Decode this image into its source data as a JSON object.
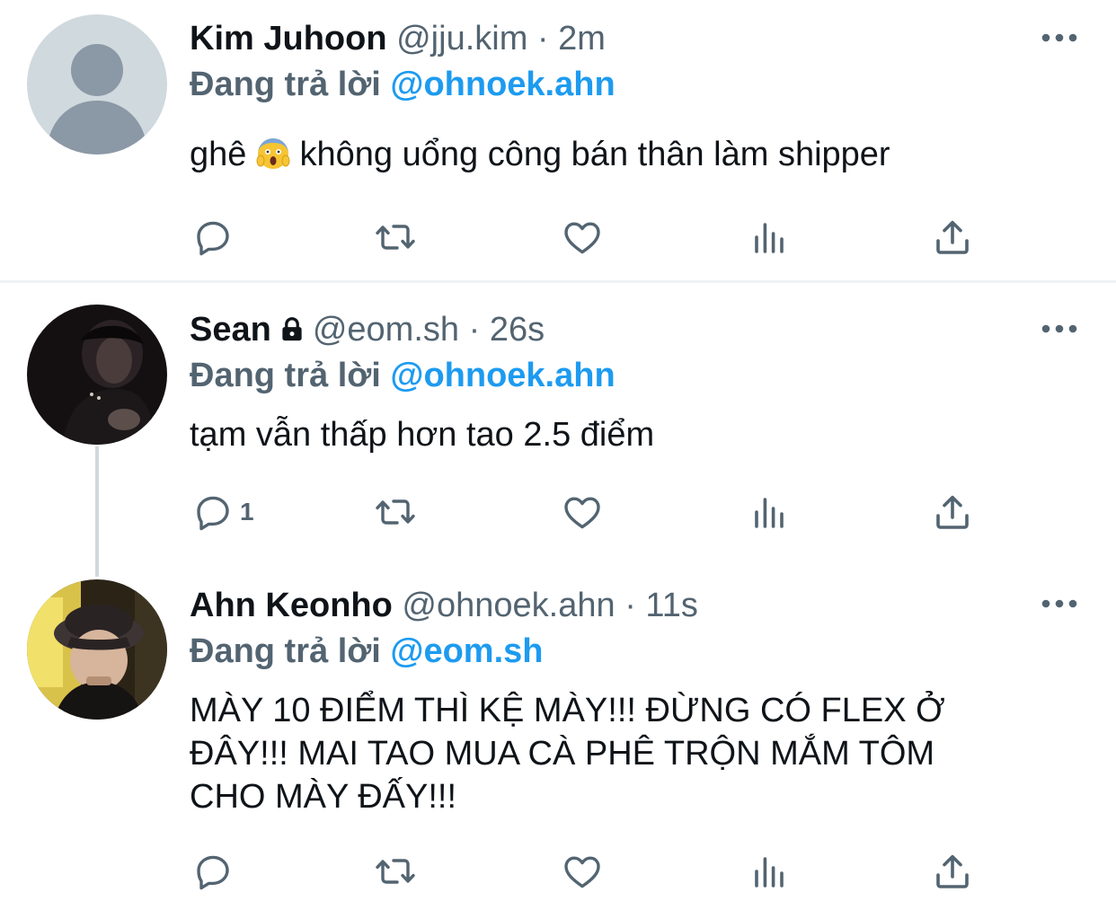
{
  "tweets": [
    {
      "name": "Kim Juhoon",
      "handle": "@jju.kim",
      "dot": "·",
      "time": "2m",
      "reply_prefix": "Đang trả lời",
      "reply_to": "@ohnoek.ahn",
      "text_before_emoji": "ghê",
      "emoji": "😱",
      "text_after_emoji": "không uổng công bán thân làm shipper",
      "reply_count": ""
    },
    {
      "name": "Sean",
      "locked": true,
      "handle": "@eom.sh",
      "dot": "·",
      "time": "26s",
      "reply_prefix": "Đang trả lời",
      "reply_to": "@ohnoek.ahn",
      "text": "tạm vẫn thấp hơn tao 2.5 điểm",
      "reply_count": "1"
    },
    {
      "name": "Ahn Keonho",
      "handle": "@ohnoek.ahn",
      "dot": "·",
      "time": "11s",
      "reply_prefix": "Đang trả lời",
      "reply_to": "@eom.sh",
      "text": "MÀY 10 ĐIỂM THÌ KỆ MÀY!!! ĐỪNG CÓ FLEX Ở ĐÂY!!! MAI TAO MUA CÀ PHÊ TRỘN MẮM TÔM CHO MÀY ĐẤY!!!",
      "reply_count": ""
    }
  ],
  "icons": {
    "reply": "reply-icon",
    "retweet": "retweet-icon",
    "like": "like-icon",
    "views": "views-icon",
    "share": "share-icon",
    "more": "more-icon",
    "lock": "lock-icon"
  },
  "colors": {
    "text": "#0f1419",
    "secondary": "#536471",
    "mention": "#1d9bf0",
    "divider": "#eff3f4",
    "thread_line": "#cfd9de"
  }
}
